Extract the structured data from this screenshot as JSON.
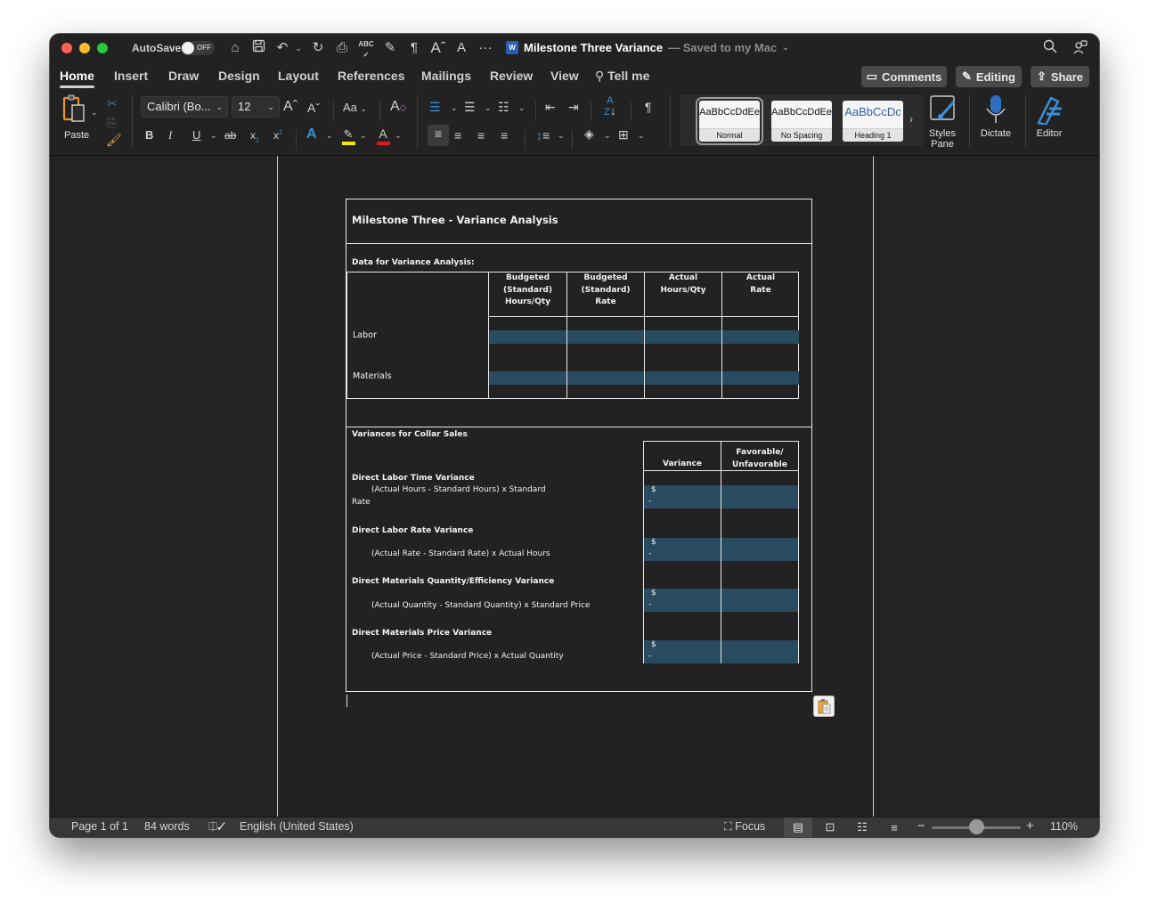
{
  "titlebar": {
    "autosave_label": "AutoSave",
    "autosave_state": "OFF",
    "doc_title": "Milestone Three Variance",
    "saved_status": "— Saved to my Mac",
    "quick_access": [
      "home-icon",
      "save-icon",
      "undo-icon",
      "redo-icon",
      "print-icon",
      "spelling-icon",
      "save-as-icon",
      "paragraph-marks-icon",
      "grow-font-icon",
      "shrink-font-icon",
      "more-icon"
    ]
  },
  "tabs": [
    {
      "label": "Home",
      "active": true
    },
    {
      "label": "Insert"
    },
    {
      "label": "Draw"
    },
    {
      "label": "Design"
    },
    {
      "label": "Layout"
    },
    {
      "label": "References"
    },
    {
      "label": "Mailings"
    },
    {
      "label": "Review"
    },
    {
      "label": "View"
    }
  ],
  "tell_me": "Tell me",
  "top_buttons": {
    "comments": "Comments",
    "editing": "Editing",
    "share": "Share"
  },
  "ribbon": {
    "paste_label": "Paste",
    "font_name": "Calibri (Bo...",
    "font_size": "12",
    "change_case": "Aa",
    "styles": [
      {
        "sample": "AaBbCcDdEe",
        "name": "Normal",
        "selected": true
      },
      {
        "sample": "AaBbCcDdEe",
        "name": "No Spacing"
      },
      {
        "sample": "AaBbCcDc",
        "name": "Heading 1"
      }
    ],
    "styles_pane_label": "Styles Pane",
    "dictate_label": "Dictate",
    "editor_label": "Editor",
    "colors": {
      "highlight": "#f5e500",
      "font_color": "#e0191d",
      "text_effect": "#3a8fd9"
    }
  },
  "document": {
    "title": "Milestone Three - Variance Analysis",
    "data_section_label": "Data for Variance Analysis:",
    "data_table": {
      "headers": [
        "Budgeted (Standard) Hours/Qty",
        "Budgeted (Standard) Rate",
        "Actual Hours/Qty",
        "Actual Rate"
      ],
      "header_lines": [
        [
          "Budgeted",
          "(Standard)",
          "Hours/Qty"
        ],
        [
          "Budgeted",
          "(Standard)",
          "Rate"
        ],
        [
          "Actual",
          "Hours/Qty"
        ],
        [
          "Actual",
          "Rate"
        ]
      ],
      "rows": [
        {
          "label": "Labor",
          "values": [
            "",
            "",
            "",
            ""
          ]
        },
        {
          "label": "Materials",
          "values": [
            "",
            "",
            "",
            ""
          ]
        }
      ]
    },
    "variance_section_label": "Variances for Collar Sales",
    "variance_table": {
      "headers": [
        "Variance",
        "Favorable/ Unfavorable"
      ],
      "header_fav_lines": [
        "Favorable/",
        "Unfavorable"
      ],
      "rows": [
        {
          "name": "Direct Labor Time Variance",
          "formula": "(Actual Hours - Standard Hours) x Standard",
          "formula_wrap": "Rate",
          "variance_symbol": "$",
          "variance_value": "-",
          "fav_unfav": ""
        },
        {
          "name": "Direct Labor Rate Variance",
          "formula": "(Actual Rate - Standard Rate) x Actual Hours",
          "variance_symbol": "$",
          "variance_value": "-",
          "fav_unfav": ""
        },
        {
          "name": "Direct Materials Quantity/Efficiency Variance",
          "formula": "(Actual Quantity - Standard Quantity) x Standard Price",
          "variance_symbol": "$",
          "variance_value": "-",
          "fav_unfav": ""
        },
        {
          "name": "Direct Materials Price Variance",
          "formula": "(Actual Price - Standard Price) x Actual Quantity",
          "variance_symbol": "$",
          "variance_value": "-",
          "fav_unfav": ""
        }
      ]
    },
    "cell_fill_color": "#284b60"
  },
  "statusbar": {
    "page": "Page 1 of 1",
    "words": "84 words",
    "language": "English (United States)",
    "focus": "Focus",
    "zoom_level": "110%",
    "zoom_fraction": 0.5
  }
}
